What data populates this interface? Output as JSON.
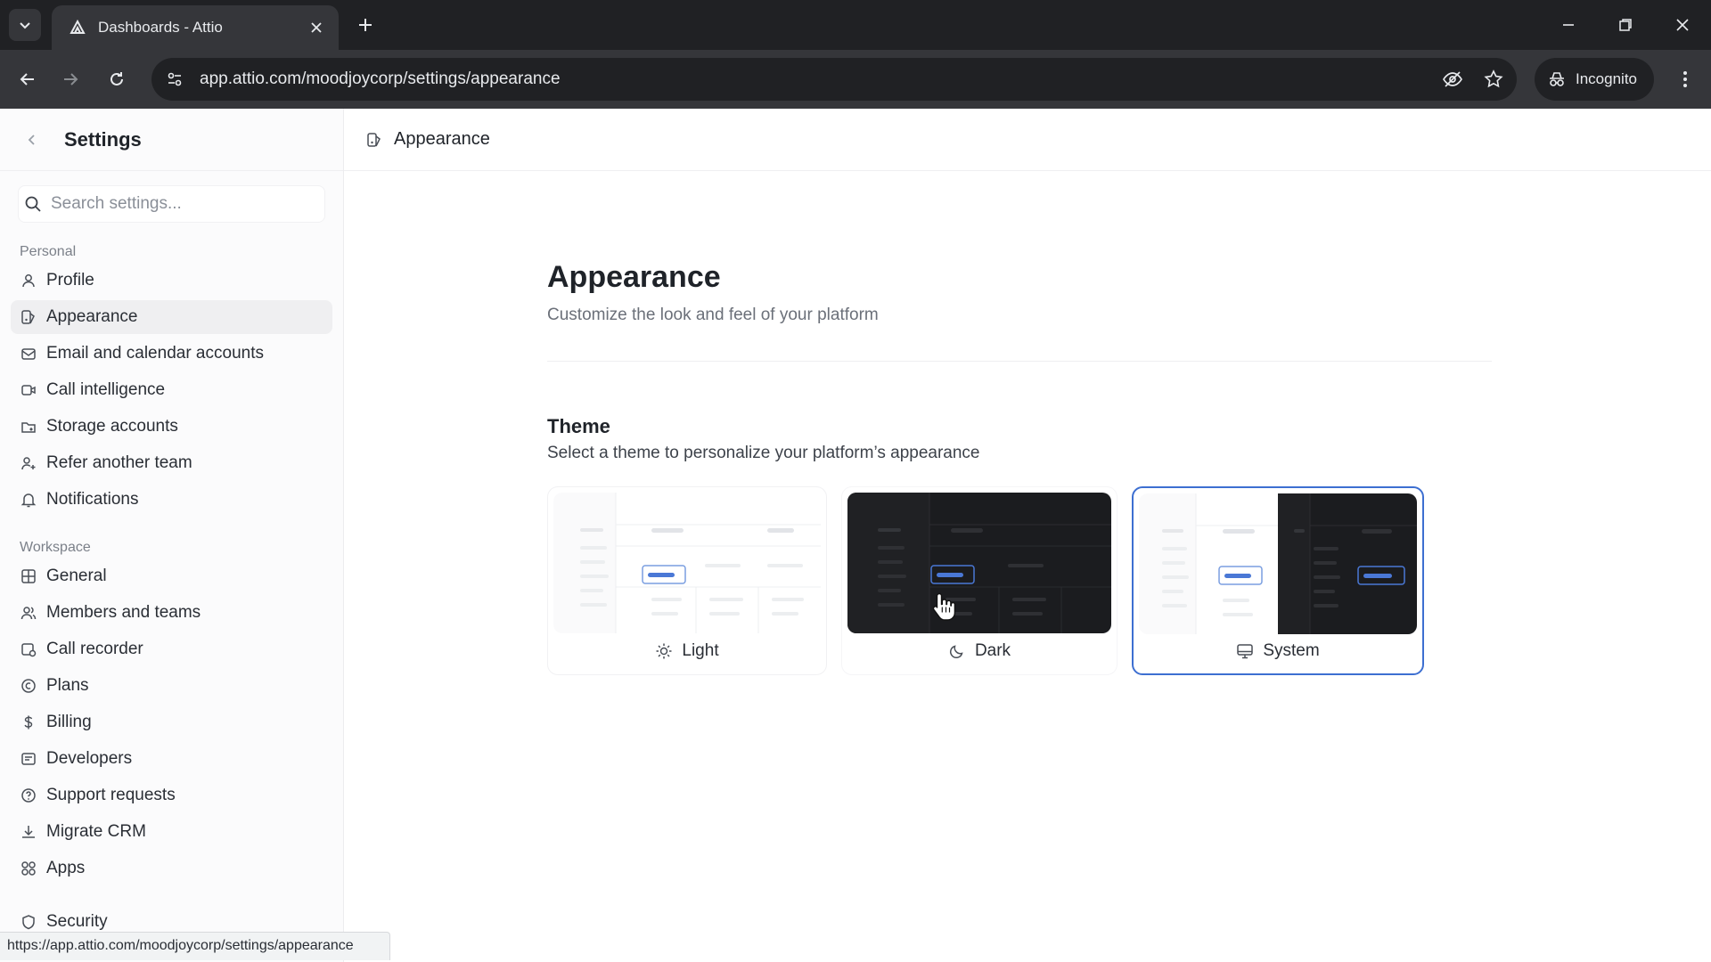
{
  "browser": {
    "tab_title": "Dashboards - Attio",
    "url": "app.attio.com/moodjoycorp/settings/appearance",
    "incognito_label": "Incognito",
    "status_url": "https://app.attio.com/moodjoycorp/settings/appearance"
  },
  "sidebar": {
    "title": "Settings",
    "search_placeholder": "Search settings...",
    "personal_label": "Personal",
    "workspace_label": "Workspace",
    "personal_items": [
      {
        "label": "Profile",
        "icon": "user-icon"
      },
      {
        "label": "Appearance",
        "icon": "appearance-icon",
        "active": true
      },
      {
        "label": "Email and calendar accounts",
        "icon": "mail-calendar-icon"
      },
      {
        "label": "Call intelligence",
        "icon": "video-icon"
      },
      {
        "label": "Storage accounts",
        "icon": "storage-icon"
      },
      {
        "label": "Refer another team",
        "icon": "refer-icon"
      },
      {
        "label": "Notifications",
        "icon": "bell-icon"
      }
    ],
    "workspace_items": [
      {
        "label": "General",
        "icon": "grid-icon"
      },
      {
        "label": "Members and teams",
        "icon": "users-icon"
      },
      {
        "label": "Call recorder",
        "icon": "recorder-icon"
      },
      {
        "label": "Plans",
        "icon": "plans-icon"
      },
      {
        "label": "Billing",
        "icon": "dollar-icon"
      },
      {
        "label": "Developers",
        "icon": "code-icon"
      },
      {
        "label": "Support requests",
        "icon": "help-icon"
      },
      {
        "label": "Migrate CRM",
        "icon": "download-icon"
      },
      {
        "label": "Apps",
        "icon": "apps-icon"
      },
      {
        "label": "Security",
        "icon": "shield-icon"
      }
    ]
  },
  "main": {
    "breadcrumb": "Appearance",
    "title": "Appearance",
    "subtitle": "Customize the look and feel of your platform",
    "theme": {
      "title": "Theme",
      "subtitle": "Select a theme to personalize your platform’s appearance",
      "options": [
        {
          "label": "Light",
          "icon": "sun-icon"
        },
        {
          "label": "Dark",
          "icon": "moon-icon"
        },
        {
          "label": "System",
          "icon": "monitor-icon",
          "selected": true
        }
      ]
    }
  },
  "colors": {
    "accent": "#3d6fd1",
    "chrome_dark": "#202124",
    "chrome_mid": "#35363a"
  }
}
